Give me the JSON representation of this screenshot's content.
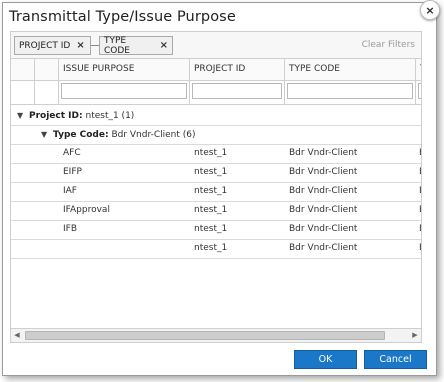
{
  "dialog": {
    "title": "Transmittal Type/Issue Purpose",
    "close_glyph": "×"
  },
  "group_bar": {
    "chips": [
      {
        "label": "PROJECT ID",
        "remove_glyph": "×"
      },
      {
        "label": "TYPE CODE",
        "remove_glyph": "×"
      }
    ],
    "clear_filters": "Clear Filters"
  },
  "grid": {
    "columns": [
      "",
      "",
      "ISSUE PURPOSE",
      "PROJECT ID",
      "TYPE CODE",
      "T"
    ],
    "groups": [
      {
        "label": "Project ID:",
        "value": "ntest_1 (1)",
        "expander": "▼"
      },
      {
        "label": "Type Code:",
        "value": "Bdr Vndr-Client (6)",
        "expander": "▼"
      }
    ],
    "rows": [
      [
        "AFC",
        "ntest_1",
        "Bdr Vndr-Client",
        "Bc"
      ],
      [
        "EIFP",
        "ntest_1",
        "Bdr Vndr-Client",
        "Bc"
      ],
      [
        "IAF",
        "ntest_1",
        "Bdr Vndr-Client",
        "Bc"
      ],
      [
        "IFApproval",
        "ntest_1",
        "Bdr Vndr-Client",
        "Bc"
      ],
      [
        "IFB",
        "ntest_1",
        "Bdr Vndr-Client",
        "Bc"
      ],
      [
        "",
        "ntest_1",
        "Bdr Vndr-Client",
        "Bc"
      ]
    ]
  },
  "scrollbar": {
    "left_arrow": "◀",
    "right_arrow": "▶"
  },
  "buttons": {
    "ok": "OK",
    "cancel": "Cancel"
  }
}
